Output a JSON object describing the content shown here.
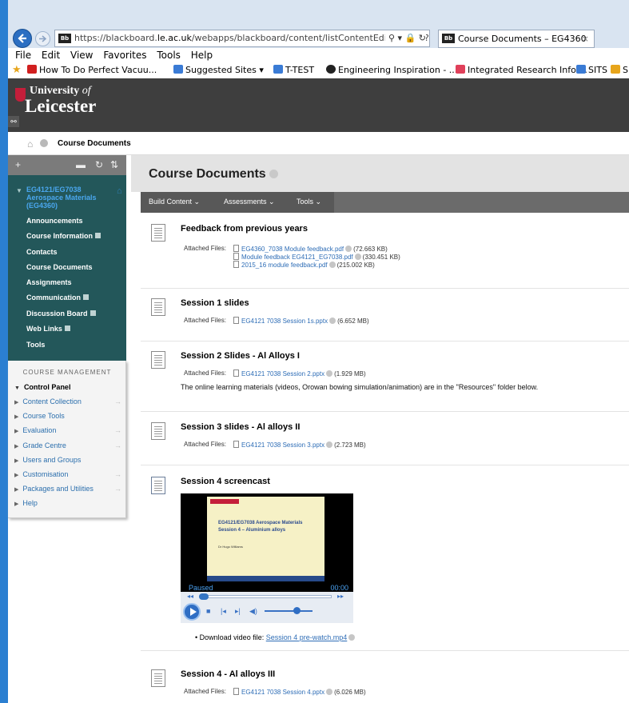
{
  "browser": {
    "url_prefix": "https://blackboard.",
    "url_domain": "le.ac.uk",
    "url_suffix": "/webapps/blackboard/content/listContentEditable.jsp?cor",
    "tab_title": "Course Documents – EG4360",
    "tab_close": "×",
    "menu": [
      "File",
      "Edit",
      "View",
      "Favorites",
      "Tools",
      "Help"
    ],
    "favorites": [
      {
        "label": "How To Do Perfect Vacuu...",
        "color": "#d11f1f"
      },
      {
        "label": "Suggested Sites ▾",
        "color": "#3a7bd5"
      },
      {
        "label": "T-TEST",
        "color": "#3a7bd5"
      },
      {
        "label": "Engineering Inspiration - ...",
        "color": "#222222"
      },
      {
        "label": "Integrated Research Infor...",
        "color": "#e0405a"
      },
      {
        "label": "SITS",
        "color": "#3a7bd5"
      },
      {
        "label": "Space Vehicle Desi",
        "color": "#e7a51b"
      }
    ]
  },
  "header": {
    "university": "University",
    "of": "of",
    "leicester": "Leicester"
  },
  "breadcrumb": {
    "current": "Course Documents"
  },
  "nav": {
    "course_name": "EG4121/EG7038 Aerospace Materials (EG4360)",
    "items": [
      {
        "label": "Announcements",
        "icon": false
      },
      {
        "label": "Course Information",
        "icon": true
      },
      {
        "label": "Contacts",
        "icon": false
      },
      {
        "label": "Course Documents",
        "icon": false
      },
      {
        "label": "Assignments",
        "icon": false
      },
      {
        "label": "Communication",
        "icon": true
      },
      {
        "label": "Discussion Board",
        "icon": true
      },
      {
        "label": "Web Links",
        "icon": true
      },
      {
        "label": "Tools",
        "icon": false
      }
    ]
  },
  "course_management": {
    "title": "COURSE MANAGEMENT",
    "control_panel": "Control Panel",
    "items": [
      {
        "label": "Content Collection",
        "arrow": true
      },
      {
        "label": "Course Tools",
        "arrow": false
      },
      {
        "label": "Evaluation",
        "arrow": true
      },
      {
        "label": "Grade Centre",
        "arrow": true
      },
      {
        "label": "Users and Groups",
        "arrow": false
      },
      {
        "label": "Customisation",
        "arrow": true
      },
      {
        "label": "Packages and Utilities",
        "arrow": true
      },
      {
        "label": "Help",
        "arrow": false
      }
    ]
  },
  "page": {
    "title": "Course Documents",
    "actions": [
      "Build Content ⌄",
      "Assessments ⌄",
      "Tools ⌄"
    ],
    "attached_label": "Attached Files:"
  },
  "items": [
    {
      "title": "Feedback from previous years",
      "files": [
        {
          "name": "EG4360_7038 Module feedback.pdf",
          "size": "(72.663 KB)"
        },
        {
          "name": "Module feedback EG4121_EG7038.pdf",
          "size": "(330.451 KB)"
        },
        {
          "name": "2015_16 module feedback.pdf",
          "size": "(215.002 KB)"
        }
      ]
    },
    {
      "title": "Session 1 slides",
      "files": [
        {
          "name": "EG4121 7038 Session 1s.pptx",
          "size": "(6.652 MB)"
        }
      ]
    },
    {
      "title": "Session 2 Slides - Al Alloys I",
      "files": [
        {
          "name": "EG4121 7038 Session 2.pptx",
          "size": "(1.929 MB)"
        }
      ],
      "description": "The online learning materials (videos, Orowan bowing simulation/animation) are in the \"Resources\" folder below."
    },
    {
      "title": "Session 3 slides - Al alloys II",
      "files": [
        {
          "name": "EG4121 7038 Session 3.pptx",
          "size": "(2.723 MB)"
        }
      ]
    },
    {
      "title": "Session 4 screencast",
      "video": {
        "slide_line1": "EG4121/EG7038 Aerospace Materials",
        "slide_line2": "Session 4 – Aluminium alloys",
        "slide_author": "Dr Hugo Williams",
        "status": "Paused",
        "time": "00:00"
      },
      "download_label": "Download video file:",
      "download_link": "Session 4 pre-watch.mp4"
    },
    {
      "title": "Session 4 - Al alloys III",
      "files": [
        {
          "name": "EG4121 7038 Session 4.pptx",
          "size": "(6.026 MB)"
        }
      ]
    }
  ]
}
